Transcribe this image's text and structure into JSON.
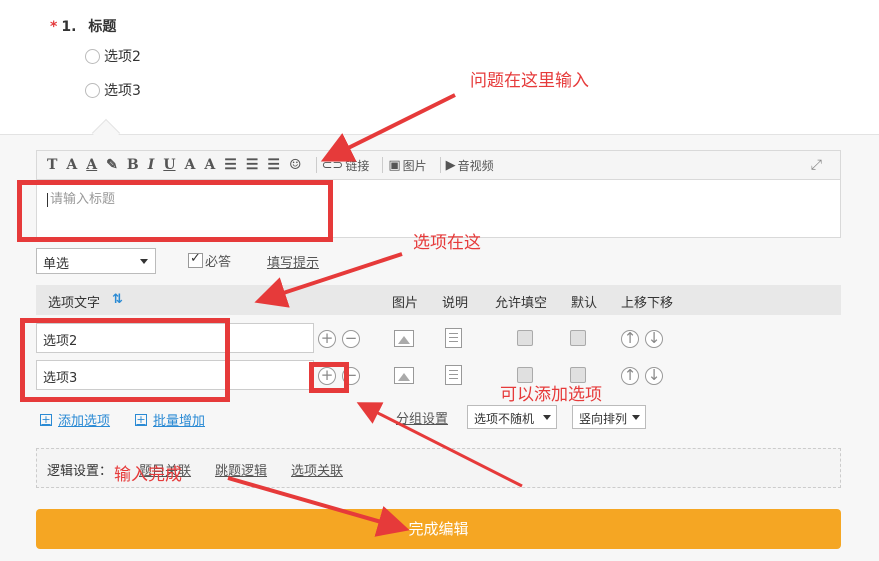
{
  "question": {
    "required_mark": "*",
    "number": "1.",
    "title": "标题",
    "options": [
      "选项2",
      "选项3"
    ]
  },
  "toolbar": {
    "buttons": [
      "T",
      "A",
      "A",
      "A",
      "B",
      "I",
      "U",
      "A",
      "A"
    ],
    "link_label": "链接",
    "image_label": "图片",
    "video_label": "音视频"
  },
  "title_input": {
    "placeholder": "请输入标题"
  },
  "question_type": {
    "selected": "单选"
  },
  "required_label": "必答",
  "fill_hint": "填写提示",
  "option_table": {
    "headers": {
      "option_text": "选项文字",
      "image": "图片",
      "description": "说明",
      "allow_fill": "允许填空",
      "default": "默认",
      "move": "上移下移"
    },
    "rows": [
      {
        "value": "选项2"
      },
      {
        "value": "选项3"
      }
    ]
  },
  "actions": {
    "add_option": "添加选项",
    "batch_add": "批量增加",
    "group_settings": "分组设置",
    "random_select": "选项不随机",
    "layout_select": "竖向排列"
  },
  "logic": {
    "label": "逻辑设置：",
    "links": [
      "题目关联",
      "跳题逻辑",
      "选项关联"
    ]
  },
  "finish_button": "完成编辑",
  "annotations": {
    "title_here": "问题在这里输入",
    "options_here": "选项在这",
    "add_options": "可以添加选项",
    "enter_done": "输入完成"
  },
  "colors": {
    "accent": "#2a8ad4",
    "finish": "#f5a623",
    "annotation_red": "#e63a3a",
    "required_star": "#e4393c"
  }
}
